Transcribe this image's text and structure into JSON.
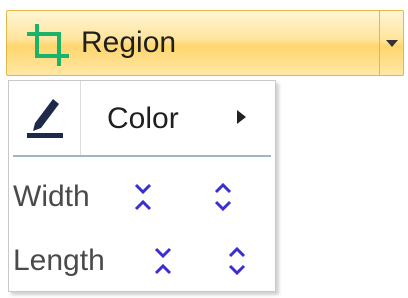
{
  "region_button": {
    "label": "Region",
    "icon": "crop-icon",
    "dropdown_icon": "chevron-down-icon"
  },
  "menu": {
    "color_item": {
      "label": "Color",
      "icon": "pen-icon",
      "submenu_icon": "chevron-right-icon"
    },
    "width_item": {
      "label": "Width",
      "decrease_icon": "collapse-icon",
      "increase_icon": "expand-icon"
    },
    "length_item": {
      "label": "Length",
      "decrease_icon": "collapse-icon",
      "increase_icon": "expand-icon"
    }
  },
  "colors": {
    "crop_icon": "#1bb36b",
    "spin_icon": "#3b2fd1",
    "pen": "#1d2a4a",
    "button_border": "#e3b74a"
  }
}
